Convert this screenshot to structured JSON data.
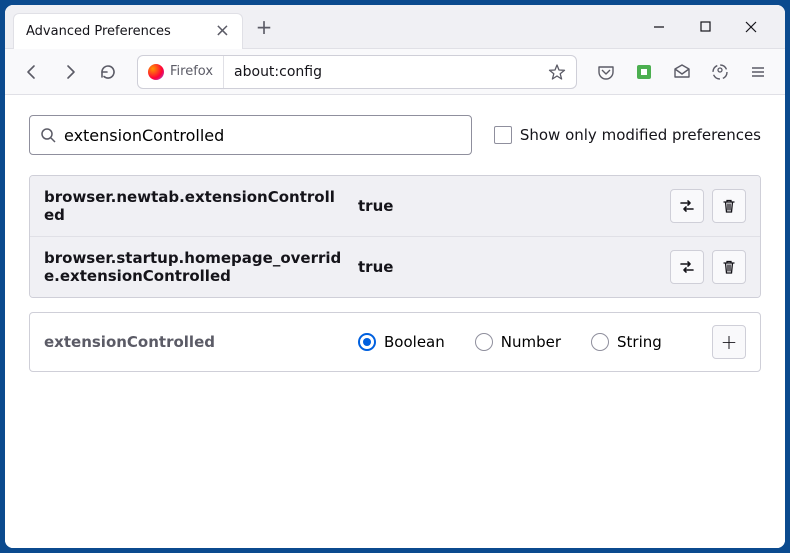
{
  "tab": {
    "title": "Advanced Preferences"
  },
  "urlbar": {
    "identity": "Firefox",
    "url": "about:config"
  },
  "config": {
    "search_value": "extensionControlled",
    "show_modified_label": "Show only modified preferences",
    "show_modified_checked": false,
    "rows": [
      {
        "name": "browser.newtab.extensionControlled",
        "value": "true"
      },
      {
        "name": "browser.startup.homepage_override.extensionControlled",
        "value": "true"
      }
    ],
    "add_row": {
      "name": "extensionControlled",
      "options": [
        "Boolean",
        "Number",
        "String"
      ],
      "selected": "Boolean"
    }
  }
}
